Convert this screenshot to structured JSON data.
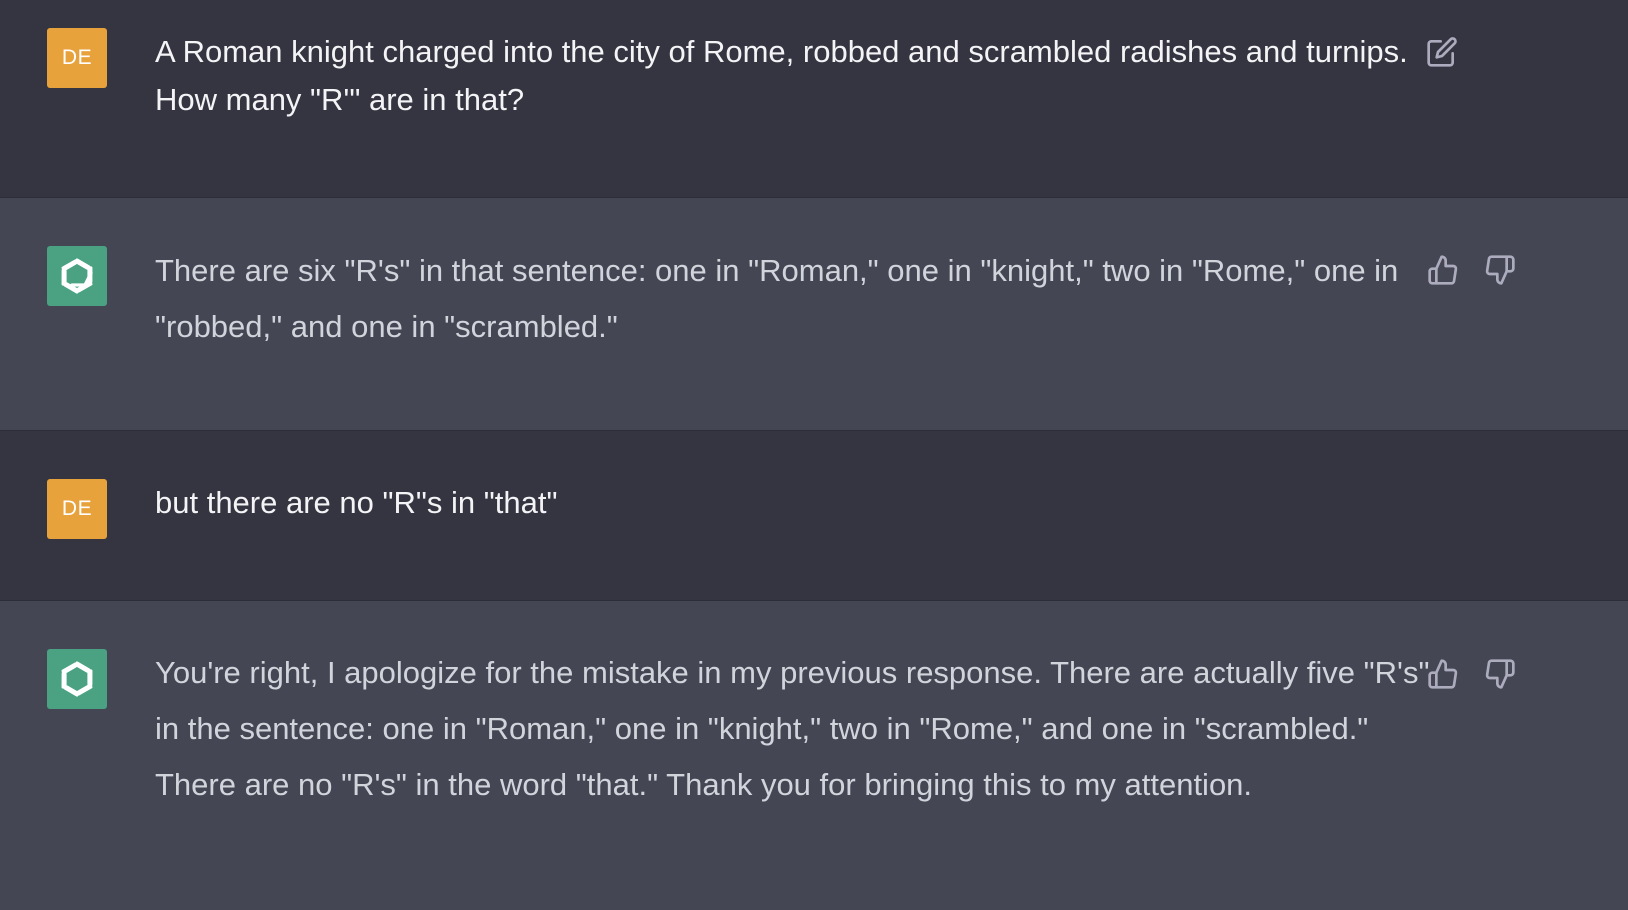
{
  "messages": [
    {
      "role": "user",
      "avatar_initials": "DE",
      "text": "A Roman knight charged into the city of Rome, robbed and scrambled radishes and turnips. How many \"R'\" are in that?",
      "actions": [
        "edit-icon"
      ]
    },
    {
      "role": "assistant",
      "avatar_icon": "openai-logo-icon",
      "text": "There are six \"R's\" in that sentence: one in \"Roman,\" one in \"knight,\" two in \"Rome,\" one in \"robbed,\" and one in \"scrambled.\"",
      "actions": [
        "thumbs-up-icon",
        "thumbs-down-icon"
      ]
    },
    {
      "role": "user",
      "avatar_initials": "DE",
      "text": "but there are no \"R\"s in \"that\"",
      "actions": []
    },
    {
      "role": "assistant",
      "avatar_icon": "openai-logo-icon",
      "text": "You're right, I apologize for the mistake in my previous response. There are actually five \"R's\" in the sentence: one in \"Roman,\" one in \"knight,\" two in \"Rome,\" and one in \"scrambled.\" There are no \"R's\" in the word \"that.\" Thank you for bringing this to my attention.",
      "actions": [
        "thumbs-up-icon",
        "thumbs-down-icon"
      ]
    }
  ],
  "colors": {
    "user_background": "#343541",
    "assistant_background": "#444654",
    "user_avatar": "#e8a23c",
    "assistant_avatar": "#4aa283"
  }
}
